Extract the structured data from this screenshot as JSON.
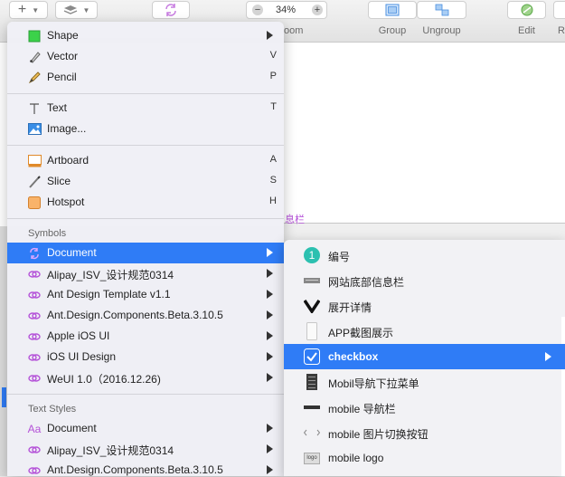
{
  "toolbar": {
    "zoom_value": "34%",
    "zoom_minus": "−",
    "zoom_plus": "+",
    "insert_icon": "+",
    "captions": {
      "group": "Group",
      "ungroup": "Ungroup",
      "edit": "Edit",
      "partial_right": "R",
      "partial_zoom": "oom"
    }
  },
  "canvas": {
    "partial_label": "息栏"
  },
  "menu": {
    "items": [
      {
        "label": "Shape",
        "icon": "square-shape-icon",
        "shortcut": ""
      },
      {
        "label": "Vector",
        "icon": "vector-pen-icon",
        "shortcut": "V"
      },
      {
        "label": "Pencil",
        "icon": "pencil-icon",
        "shortcut": "P"
      },
      {
        "label": "Text",
        "icon": "text-cursor-icon",
        "shortcut": "T"
      },
      {
        "label": "Image...",
        "icon": "image-icon",
        "shortcut": ""
      },
      {
        "label": "Artboard",
        "icon": "artboard-icon",
        "shortcut": "A"
      },
      {
        "label": "Slice",
        "icon": "slice-knife-icon",
        "shortcut": "S"
      },
      {
        "label": "Hotspot",
        "icon": "hotspot-icon",
        "shortcut": "H"
      }
    ],
    "symbols_header": "Symbols",
    "symbols": [
      {
        "label": "Document",
        "selected": true
      },
      {
        "label": "Alipay_ISV_设计规范0314",
        "selected": false
      },
      {
        "label": "Ant Design Template v1.1",
        "selected": false
      },
      {
        "label": "Ant.Design.Components.Beta.3.10.5",
        "selected": false
      },
      {
        "label": "Apple iOS UI",
        "selected": false
      },
      {
        "label": "iOS UI Design",
        "selected": false
      },
      {
        "label": "WeUI 1.0（2016.12.26)",
        "selected": false
      }
    ],
    "text_styles_header": "Text Styles",
    "text_styles": [
      {
        "label": "Document"
      },
      {
        "label": "Alipay_ISV_设计规范0314"
      },
      {
        "label": "Ant.Design.Components.Beta.3.10.5"
      }
    ]
  },
  "submenu": {
    "items": [
      {
        "label": "编号",
        "icon": "numbered-badge-icon",
        "badge": "1",
        "selected": false
      },
      {
        "label": "网站底部信息栏",
        "icon": "footer-bar-icon",
        "selected": false
      },
      {
        "label": "展开详情",
        "icon": "chevron-expand-icon",
        "selected": false
      },
      {
        "label": "APP截图展示",
        "icon": "phone-screenshot-icon",
        "selected": false
      },
      {
        "label": "checkbox",
        "icon": "checkbox-icon",
        "selected": true
      },
      {
        "label": "Mobil导航下拉菜单",
        "icon": "dropdown-menu-icon",
        "selected": false
      },
      {
        "label": "mobile 导航栏",
        "icon": "nav-bar-icon",
        "selected": false
      },
      {
        "label": "mobile 图片切换按钮",
        "icon": "image-switch-icon",
        "selected": false
      },
      {
        "label": "mobile logo",
        "icon": "logo-icon",
        "logo_text": "logo",
        "selected": false
      }
    ]
  },
  "colors": {
    "selection": "#2f7cf6",
    "symbol_purple": "#b451d8",
    "badge_teal": "#2cc0b0"
  }
}
